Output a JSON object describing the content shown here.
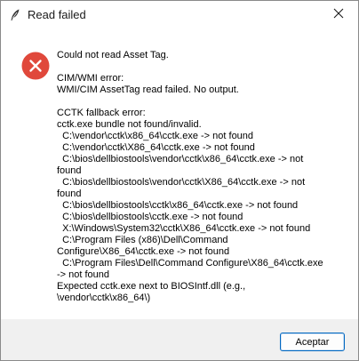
{
  "window": {
    "title": "Read failed",
    "app_icon": "feather-icon",
    "close_icon": "close-icon"
  },
  "dialog": {
    "icon": "error-icon",
    "message_lines": [
      "Could not read Asset Tag.",
      "",
      "CIM/WMI error:",
      "WMI/CIM AssetTag read failed. No output.",
      "",
      "CCTK fallback error:",
      "cctk.exe bundle not found/invalid.",
      "  C:\\vendor\\cctk\\x86_64\\cctk.exe -> not found",
      "  C:\\vendor\\cctk\\X86_64\\cctk.exe -> not found",
      "  C:\\bios\\dellbiostools\\vendor\\cctk\\x86_64\\cctk.exe -> not",
      "found",
      "  C:\\bios\\dellbiostools\\vendor\\cctk\\X86_64\\cctk.exe -> not",
      "found",
      "  C:\\bios\\dellbiostools\\cctk\\x86_64\\cctk.exe -> not found",
      "  C:\\bios\\dellbiostools\\cctk.exe -> not found",
      "  X:\\Windows\\System32\\cctk\\X86_64\\cctk.exe -> not found",
      "  C:\\Program Files (x86)\\Dell\\Command",
      "Configure\\X86_64\\cctk.exe -> not found",
      "  C:\\Program Files\\Dell\\Command Configure\\X86_64\\cctk.exe",
      "-> not found",
      "Expected cctk.exe next to BIOSIntf.dll (e.g.,",
      "\\vendor\\cctk\\x86_64\\)"
    ]
  },
  "footer": {
    "ok_label": "Aceptar"
  },
  "colors": {
    "error_red": "#e0483b",
    "accent_border": "#0067c0",
    "footer_bg": "#f0f0f0"
  }
}
